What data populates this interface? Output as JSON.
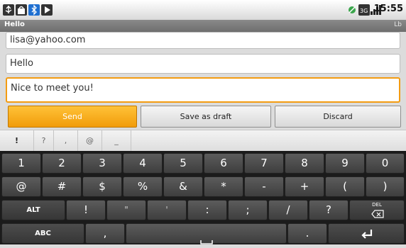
{
  "status_bar": {
    "time": "15:55",
    "left_icons": [
      "usb-icon",
      "bag-icon",
      "bluetooth-icon",
      "play-icon"
    ],
    "right_icons": [
      "sync-icon",
      "network-3g-icon",
      "signal-icon"
    ]
  },
  "title_bar": {
    "title": "Hello",
    "right_text": "Lb"
  },
  "compose": {
    "to": "lisa@yahoo.com",
    "subject": "Hello",
    "body": "Nice to meet you!"
  },
  "actions": {
    "send": "Send",
    "save_draft": "Save as draft",
    "discard": "Discard"
  },
  "suggestions": [
    "!",
    "?",
    ",",
    "@",
    "_"
  ],
  "keyboard": {
    "row1": [
      "1",
      "2",
      "3",
      "4",
      "5",
      "6",
      "7",
      "8",
      "9",
      "0"
    ],
    "row2": [
      "@",
      "#",
      "$",
      "%",
      "&",
      "*",
      "-",
      "+",
      "(",
      ")"
    ],
    "row3": [
      "ALT",
      "!",
      "\"",
      "'",
      ":",
      ";",
      "/",
      "?"
    ],
    "del_label": "DEL",
    "abc_label": "ABC",
    "comma": ",",
    "period": "."
  },
  "colors": {
    "accent": "#f39c12",
    "send_top": "#ffc238",
    "send_bottom": "#f19c0b",
    "keyboard_bg": "#1b1b1b"
  }
}
